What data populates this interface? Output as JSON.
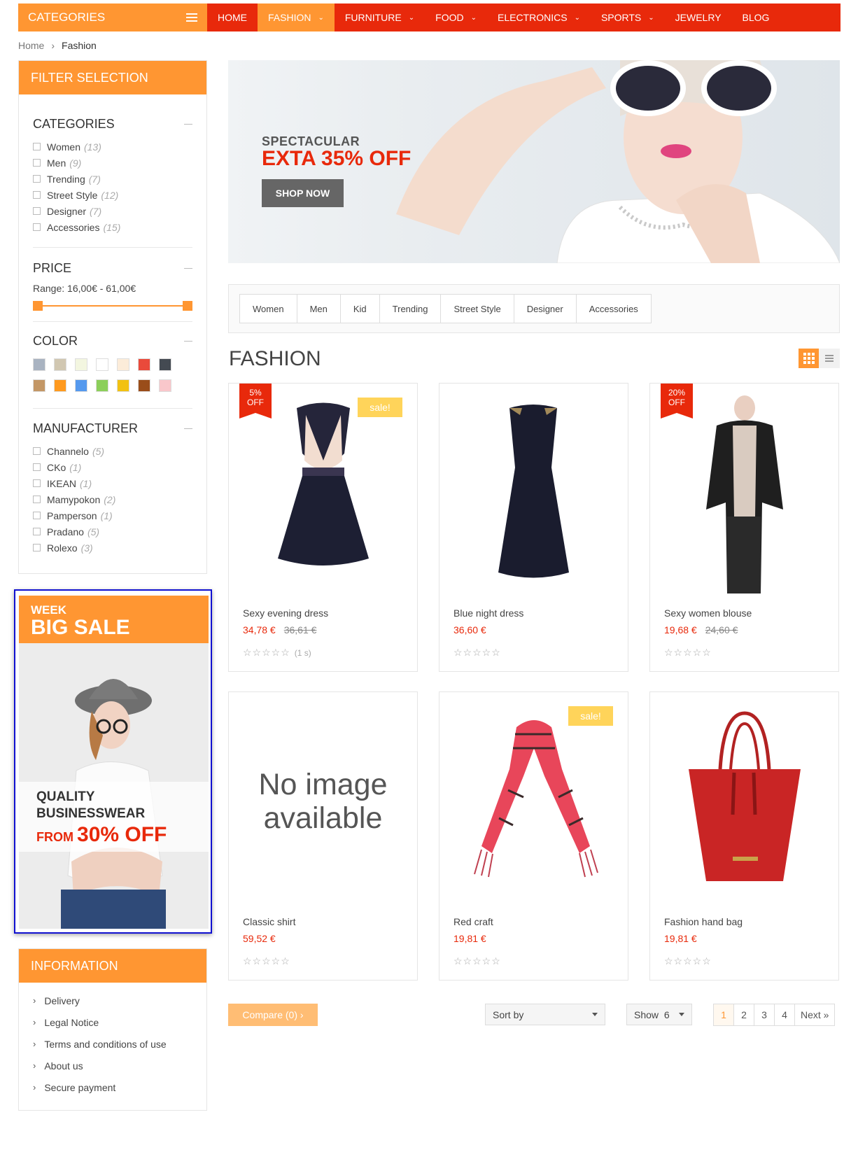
{
  "topbar": {
    "categories_label": "CATEGORIES",
    "nav": [
      {
        "label": "HOME",
        "dropdown": false,
        "active": false
      },
      {
        "label": "FASHION",
        "dropdown": true,
        "active": true
      },
      {
        "label": "FURNITURE",
        "dropdown": true,
        "active": false
      },
      {
        "label": "FOOD",
        "dropdown": true,
        "active": false
      },
      {
        "label": "ELECTRONICS",
        "dropdown": true,
        "active": false
      },
      {
        "label": "SPORTS",
        "dropdown": true,
        "active": false
      },
      {
        "label": "JEWELRY",
        "dropdown": false,
        "active": false
      },
      {
        "label": "BLOG",
        "dropdown": false,
        "active": false
      }
    ]
  },
  "breadcrumb": {
    "home": "Home",
    "current": "Fashion"
  },
  "filter": {
    "title": "FILTER SELECTION",
    "categories": {
      "title": "CATEGORIES",
      "items": [
        {
          "label": "Women",
          "count": "(13)"
        },
        {
          "label": "Men",
          "count": "(9)"
        },
        {
          "label": "Trending",
          "count": "(7)"
        },
        {
          "label": "Street Style",
          "count": "(12)"
        },
        {
          "label": "Designer",
          "count": "(7)"
        },
        {
          "label": "Accessories",
          "count": "(15)"
        }
      ]
    },
    "price": {
      "title": "PRICE",
      "range": "Range: 16,00€ - 61,00€"
    },
    "color": {
      "title": "COLOR",
      "swatches": [
        "#a9b3c1",
        "#d1c7b1",
        "#f3f6e0",
        "#ffffff",
        "#fcecd9",
        "#e94a3b",
        "#444a52",
        "#c39766",
        "#ff9a1f",
        "#5599ee",
        "#8ccf5a",
        "#f2c112",
        "#9a4d1a",
        "#f9c7cb"
      ]
    },
    "manufacturer": {
      "title": "MANUFACTURER",
      "items": [
        {
          "label": "Channelo",
          "count": "(5)"
        },
        {
          "label": "CKo",
          "count": "(1)"
        },
        {
          "label": "IKEAN",
          "count": "(1)"
        },
        {
          "label": "Mamypokon",
          "count": "(2)"
        },
        {
          "label": "Pamperson",
          "count": "(1)"
        },
        {
          "label": "Pradano",
          "count": "(5)"
        },
        {
          "label": "Rolexo",
          "count": "(3)"
        }
      ]
    }
  },
  "promo": {
    "week": "WEEK",
    "big_sale": "BIG SALE",
    "quality": "QUALITY",
    "businesswear": "BUSINESSWEAR",
    "from": "FROM",
    "off": "30% OFF"
  },
  "information": {
    "title": "INFORMATION",
    "links": [
      "Delivery",
      "Legal Notice",
      "Terms and conditions of use",
      "About us",
      "Secure payment"
    ]
  },
  "hero": {
    "kicker": "SPECTACULAR",
    "headline": "EXTA 35% OFF",
    "cta": "SHOP NOW"
  },
  "tabs": [
    "Women",
    "Men",
    "Kid",
    "Trending",
    "Street Style",
    "Designer",
    "Accessories"
  ],
  "heading": "FASHION",
  "products": [
    {
      "name": "Sexy evening dress",
      "price": "34,78 €",
      "old_price": "36,61 €",
      "badge": [
        "5%",
        "OFF"
      ],
      "sale": "sale!",
      "reviews": "(1 s)"
    },
    {
      "name": "Blue night dress",
      "price": "36,60 €",
      "old_price": "",
      "badge": null,
      "sale": "",
      "reviews": ""
    },
    {
      "name": "Sexy women blouse",
      "price": "19,68 €",
      "old_price": "24,60 €",
      "badge": [
        "20%",
        "OFF"
      ],
      "sale": "",
      "reviews": ""
    },
    {
      "name": "Classic shirt",
      "price": "59,52 €",
      "old_price": "",
      "badge": null,
      "sale": "",
      "reviews": "",
      "no_image": [
        "No image",
        "available"
      ]
    },
    {
      "name": "Red craft",
      "price": "19,81 €",
      "old_price": "",
      "badge": null,
      "sale": "sale!",
      "reviews": ""
    },
    {
      "name": "Fashion hand bag",
      "price": "19,81 €",
      "old_price": "",
      "badge": null,
      "sale": "",
      "reviews": ""
    }
  ],
  "stars": "☆☆☆☆☆",
  "toolbar": {
    "compare": "Compare (0)",
    "sort_label": "Sort by",
    "show_label": "Show",
    "show_value": "6",
    "pages": [
      "1",
      "2",
      "3",
      "4"
    ],
    "next": "Next"
  }
}
